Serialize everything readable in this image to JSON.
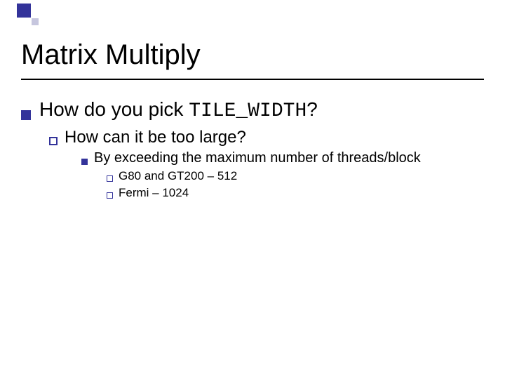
{
  "title": "Matrix Multiply",
  "l1": {
    "pre": "How do you pick ",
    "code": "TILE_WIDTH",
    "post": "?"
  },
  "l2": "How can it be too large?",
  "l3": "By exceeding the maximum number of threads/block",
  "l4a": "G80 and GT200 – 512",
  "l4b": "Fermi – 1024"
}
